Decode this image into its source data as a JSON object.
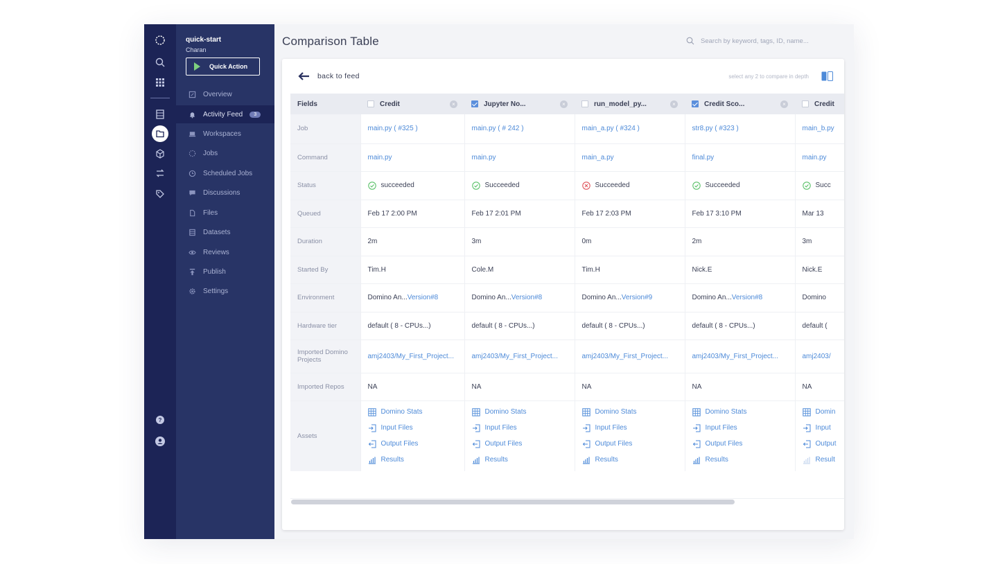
{
  "project": {
    "name": "quick-start",
    "user": "Charan",
    "quick_action": "Quick Action"
  },
  "nav": [
    {
      "label": "Overview",
      "icon": "overview-icon"
    },
    {
      "label": "Activity Feed",
      "icon": "bell-icon",
      "badge": "3",
      "active": true
    },
    {
      "label": "Workspaces",
      "icon": "laptop-icon"
    },
    {
      "label": "Jobs",
      "icon": "jobs-icon"
    },
    {
      "label": "Scheduled Jobs",
      "icon": "clock-icon"
    },
    {
      "label": "Discussions",
      "icon": "chat-icon"
    },
    {
      "label": "Files",
      "icon": "file-icon"
    },
    {
      "label": "Datasets",
      "icon": "dataset-icon"
    },
    {
      "label": "Reviews",
      "icon": "eye-icon"
    },
    {
      "label": "Publish",
      "icon": "publish-icon"
    },
    {
      "label": "Settings",
      "icon": "gear-icon"
    }
  ],
  "header": {
    "title": "Comparison Table",
    "search_placeholder": "Search by keyword, tags, ID, name..."
  },
  "card": {
    "back_label": "back to feed",
    "hint": "select any 2 to compare in depth"
  },
  "colors": {
    "rail": "#1c2456",
    "sidebar": "#283466",
    "link": "#4d8ad8",
    "success": "#5cc26a",
    "fail": "#e0555c"
  },
  "table": {
    "fields_header": "Fields",
    "row_labels": [
      "Job",
      "Command",
      "Status",
      "Queued",
      "Duration",
      "Started By",
      "Environment",
      "Hardware tier",
      "Imported Domino Projects",
      "Imported Repos",
      "Assets"
    ],
    "asset_labels": [
      "Domino Stats",
      "Input Files",
      "Output Files",
      "Results"
    ],
    "columns": [
      {
        "name": "Credit",
        "checked": false,
        "job": "main.py ( #325 )",
        "command": "main.py",
        "status": "succeeded",
        "status_ok": true,
        "queued": "Feb 17 2:00 PM",
        "duration": "2m",
        "started_by": "Tim.H",
        "env": "Domino An...",
        "env_version": "Version#8",
        "hardware": "default ( 8 - CPUs...)",
        "projects": "amj2403/My_First_Project...",
        "repos": "NA"
      },
      {
        "name": "Jupyter No...",
        "checked": true,
        "job": "main.py ( # 242 )",
        "command": "main.py",
        "status": "Succeeded",
        "status_ok": true,
        "queued": "Feb 17 2:01 PM",
        "duration": "3m",
        "started_by": "Cole.M",
        "env": "Domino An...",
        "env_version": "Version#8",
        "hardware": "default ( 8 - CPUs...)",
        "projects": "amj2403/My_First_Project...",
        "repos": "NA"
      },
      {
        "name": "run_model_py...",
        "checked": false,
        "job": "main_a.py ( #324 )",
        "command": "main_a.py",
        "status": "Succeeded",
        "status_ok": false,
        "queued": "Feb 17 2:03 PM",
        "duration": "0m",
        "started_by": "Tim.H",
        "env": "Domino An...",
        "env_version": "Version#9",
        "hardware": "default ( 8 - CPUs...)",
        "projects": "amj2403/My_First_Project...",
        "repos": "NA"
      },
      {
        "name": "Credit Sco...",
        "checked": true,
        "job": "str8.py ( #323 )",
        "command": "final.py",
        "status": "Succeeded",
        "status_ok": true,
        "queued": "Feb 17 3:10 PM",
        "duration": "2m",
        "started_by": "Nick.E",
        "env": "Domino An...",
        "env_version": "Version#8",
        "hardware": "default ( 8 - CPUs...)",
        "projects": "amj2403/My_First_Project...",
        "repos": "NA"
      },
      {
        "name": "Credit",
        "checked": false,
        "job": "main_b.py",
        "command": "main.py",
        "status": "Succ",
        "status_ok": true,
        "queued": "Mar 13",
        "duration": "3m",
        "started_by": "Nick.E",
        "env": "Domino",
        "env_version": "",
        "hardware": "default (",
        "projects": "amj2403/",
        "repos": "NA",
        "assets": [
          "Domin",
          "Input",
          "Output",
          "Result"
        ]
      }
    ]
  }
}
